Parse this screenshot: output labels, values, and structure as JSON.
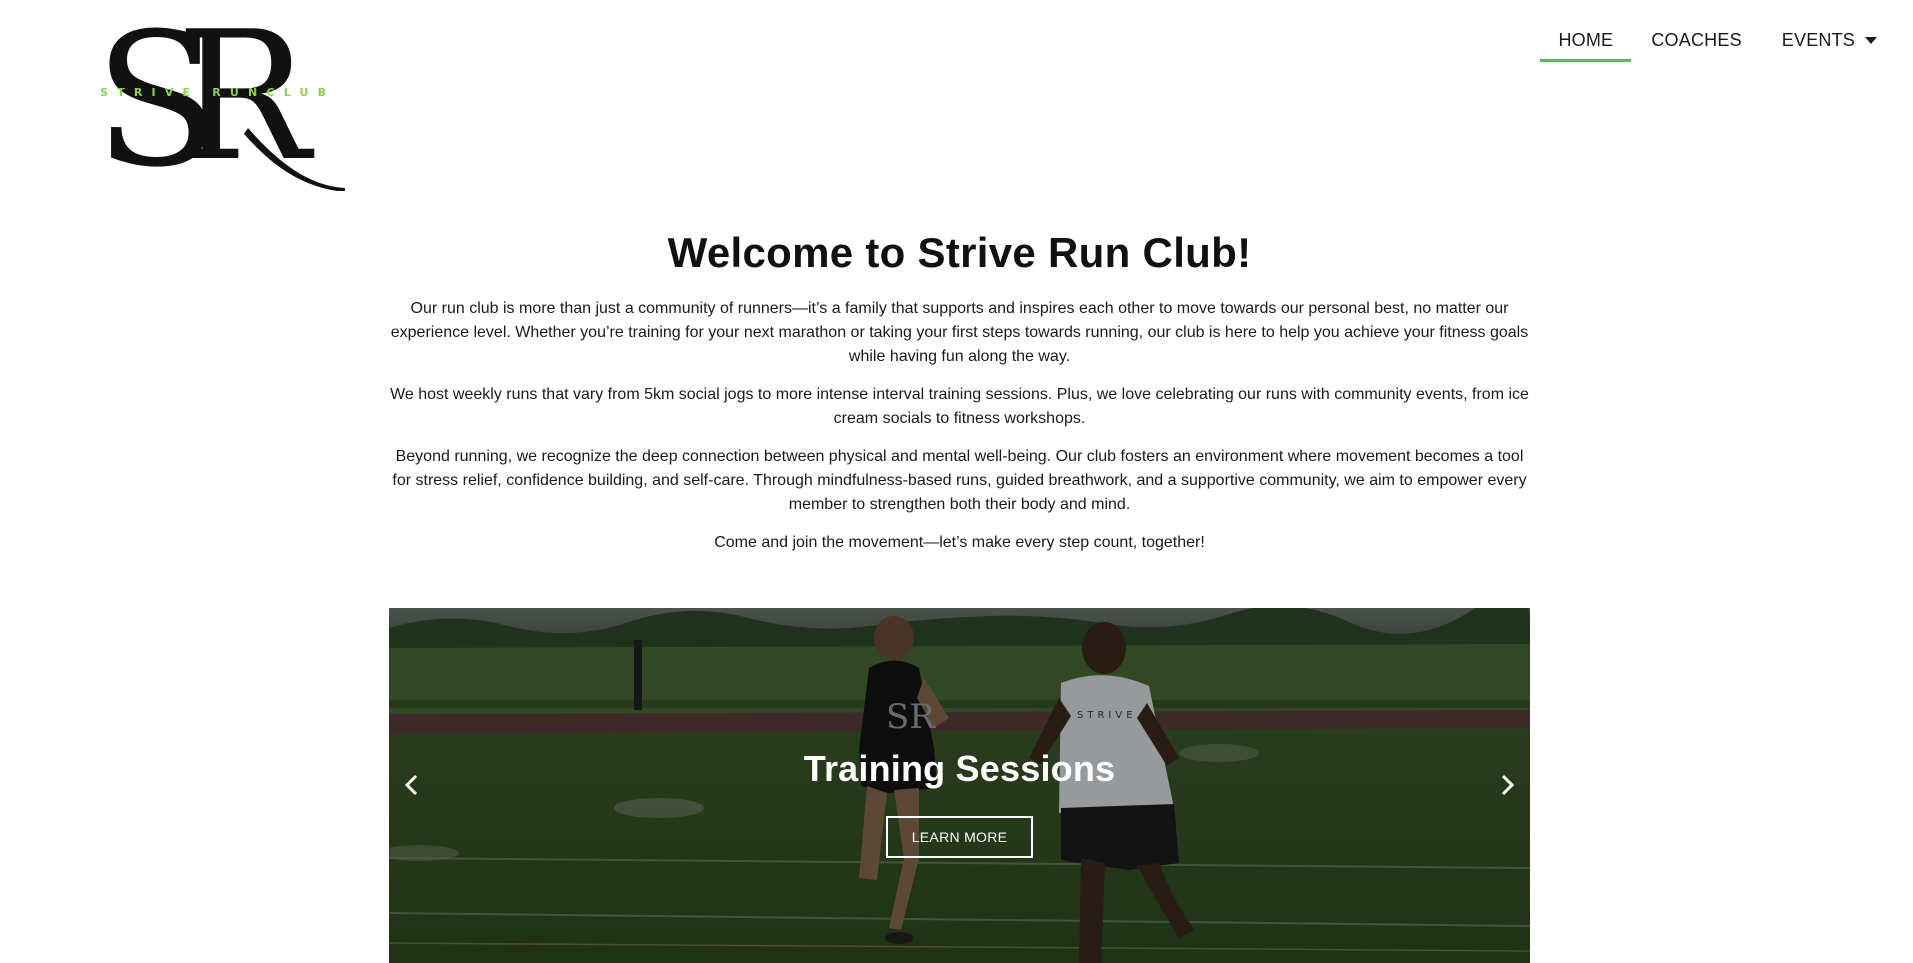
{
  "header": {
    "logo": {
      "monogram": "SR",
      "tagline": "STRIVE RUNCLUB",
      "tagline_color": "#8fd14f"
    },
    "nav": {
      "items": [
        {
          "label": "HOME",
          "active": true
        },
        {
          "label": "COACHES",
          "active": false
        },
        {
          "label": "EVENTS",
          "active": false,
          "has_dropdown": true
        }
      ],
      "active_underline_color": "#5cb85c"
    }
  },
  "main": {
    "title": "Welcome to Strive Run Club!",
    "paragraphs": [
      "Our run club is more than just a community of runners—it’s a family that supports and inspires each other to move towards our personal best, no matter our experience level. Whether you’re training for your next marathon or taking your first steps towards running, our club is here to help you achieve your fitness goals while having fun along the way.",
      "We host weekly runs that vary from 5km social jogs to more intense interval training sessions. Plus, we love celebrating our runs with community events, from ice cream socials to fitness workshops.",
      "Beyond running, we recognize the deep connection between physical and mental well-being. Our club fosters an environment where movement becomes a tool for stress relief, confidence building, and self-care. Through mindfulness-based runs, guided breathwork, and a supportive community, we aim to empower every member to strengthen both their body and mind.",
      "Come and join the movement—let’s make every step count, together!"
    ]
  },
  "carousel": {
    "slide_title": "Training Sessions",
    "button_label": "LEARN MORE",
    "prev_icon": "chevron-left-icon",
    "next_icon": "chevron-right-icon",
    "photo_shirt_text_left": "SR",
    "photo_shirt_text_right": "STRIVE"
  }
}
